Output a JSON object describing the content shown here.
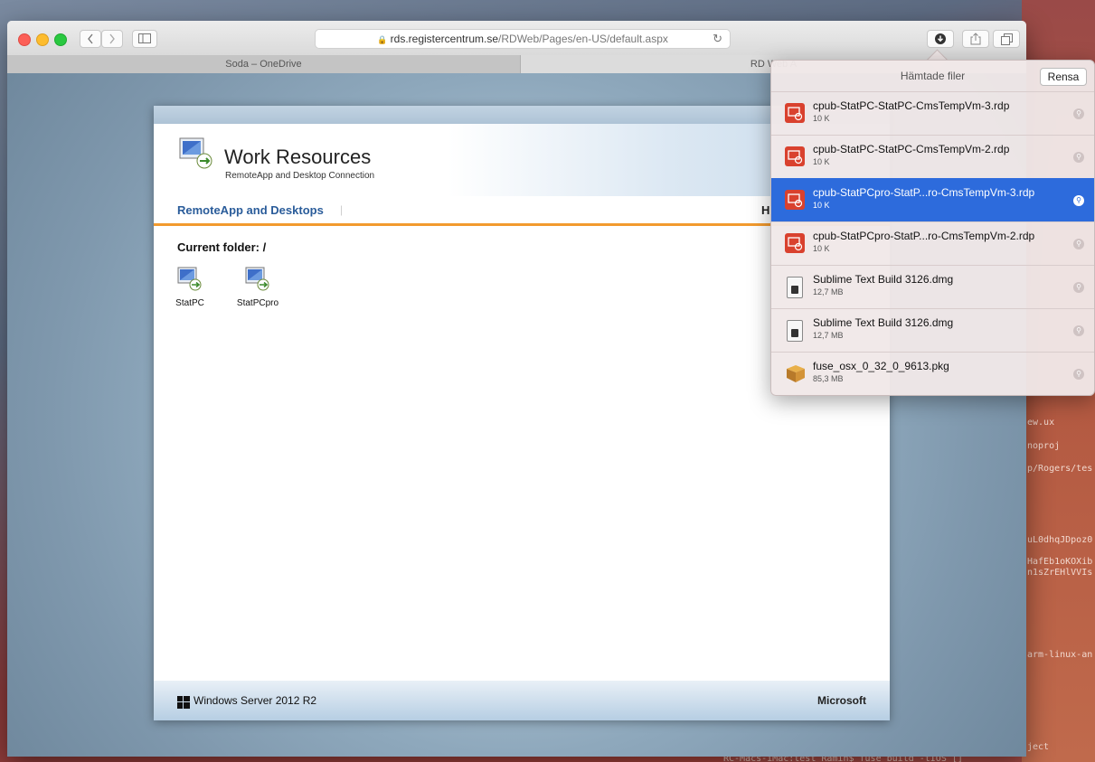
{
  "browser": {
    "url_host": "rds.registercentrum.se",
    "url_path": "/RDWeb/Pages/en-US/default.aspx",
    "tabs": [
      {
        "label": "Soda – OneDrive",
        "active": false
      },
      {
        "label": "RD Web A",
        "active": true
      }
    ]
  },
  "page": {
    "header_title": "Work Resources",
    "header_subtitle": "RemoteApp and Desktop Connection",
    "nav_remote": "RemoteApp and Desktops",
    "nav_sep": "|",
    "nav_help": "H",
    "current_folder": "Current folder: /",
    "apps": [
      {
        "label": "StatPC"
      },
      {
        "label": "StatPCpro"
      }
    ],
    "footer_os": "Windows Server 2012 R2",
    "footer_vendor": "Microsoft"
  },
  "downloads": {
    "title": "Hämtade filer",
    "clear_label": "Rensa",
    "items": [
      {
        "name": "cpub-StatPC-StatPC-CmsTempVm-3.rdp",
        "size": "10 K",
        "icon": "rdp-file-icon",
        "selected": false
      },
      {
        "name": "cpub-StatPC-StatPC-CmsTempVm-2.rdp",
        "size": "10 K",
        "icon": "rdp-file-icon",
        "selected": false
      },
      {
        "name": "cpub-StatPCpro-StatP...ro-CmsTempVm-3.rdp",
        "size": "10 K",
        "icon": "rdp-file-icon",
        "selected": true
      },
      {
        "name": "cpub-StatPCpro-StatP...ro-CmsTempVm-2.rdp",
        "size": "10 K",
        "icon": "rdp-file-icon",
        "selected": false
      },
      {
        "name": "Sublime Text Build 3126.dmg",
        "size": "12,7 MB",
        "icon": "disk-image-icon",
        "selected": false
      },
      {
        "name": "Sublime Text Build 3126.dmg",
        "size": "12,7 MB",
        "icon": "disk-image-icon",
        "selected": false
      },
      {
        "name": "fuse_osx_0_32_0_9613.pkg",
        "size": "85,3 MB",
        "icon": "package-icon",
        "selected": false
      }
    ]
  },
  "terminal": {
    "lines": [
      "ew.ux",
      "noproj",
      "p/Rogers/tes",
      "uL0dhqJDpoz0",
      "HafEb1oKOXib",
      "n1sZrEHlVVIs",
      "arm-linux-an",
      "ject"
    ],
    "bottom_line": "RC-Macs-iMac:test Ramin$ fuse build -tIOS []"
  },
  "colors": {
    "accent_selected": "#2d6bdc",
    "nav_link": "#2a5c9a",
    "nav_underline": "#f29a2e",
    "rdp_icon": "#d9412e"
  }
}
